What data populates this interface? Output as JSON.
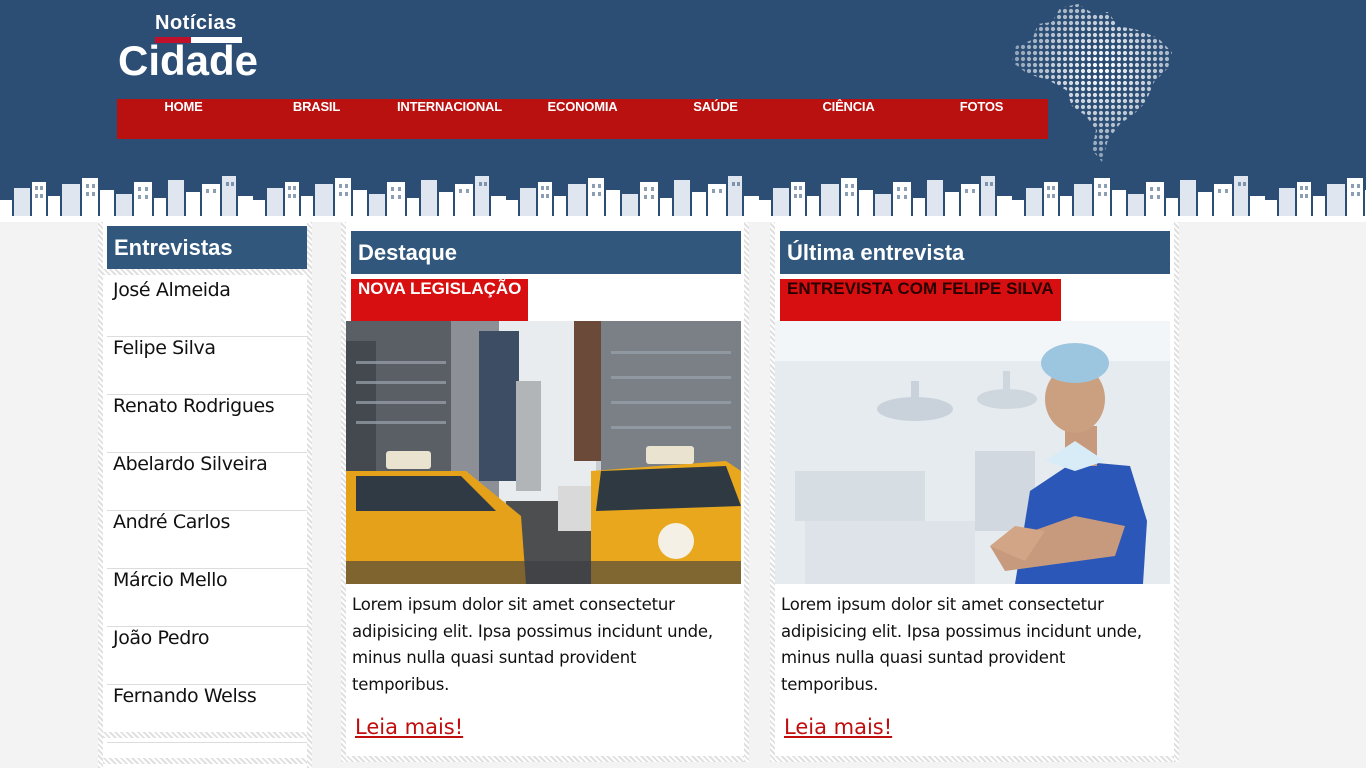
{
  "brand": {
    "top": "Notícias",
    "main": "Cidade"
  },
  "nav": [
    "HOME",
    "BRASIL",
    "INTERNACIONAL",
    "ECONOMIA",
    "SAÚDE",
    "CIÊNCIA",
    "FOTOS"
  ],
  "sidebar": {
    "title": "Entrevistas",
    "items": [
      "José Almeida",
      "Felipe Silva",
      "Renato Rodrigues",
      "Abelardo Silveira",
      "André Carlos",
      "Márcio Mello",
      "João Pedro",
      "Fernando Welss"
    ]
  },
  "featured": {
    "title": "Destaque",
    "tag": "NOVA LEGISLAÇÃO",
    "excerpt": "Lorem ipsum dolor sit amet consectetur adipisicing elit. Ipsa possimus incidunt unde, minus nulla quasi suntad provident temporibus.",
    "more": "Leia mais!"
  },
  "latest": {
    "title": "Última entrevista",
    "tag": "ENTREVISTA COM FELIPE SILVA",
    "excerpt": "Lorem ipsum dolor sit amet consectetur adipisicing elit. Ipsa possimus incidunt unde, minus nulla quasi suntad provident temporibus.",
    "more": "Leia mais!"
  },
  "colors": {
    "header_bg": "#2c4e75",
    "nav_bg": "#b91010",
    "box_title_bg": "#31577d",
    "tag_bg": "#d80f10",
    "link": "#c00d0d"
  },
  "icons": {
    "map": "brazil-dot-map",
    "skyline": "city-skyline"
  }
}
